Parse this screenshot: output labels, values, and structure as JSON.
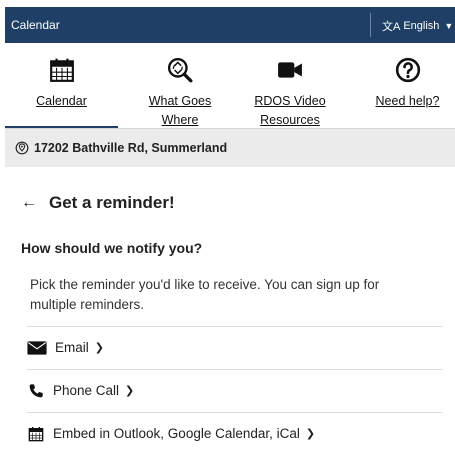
{
  "topbar": {
    "title": "Calendar",
    "language": "English",
    "language_icon": "translate-icon"
  },
  "nav": {
    "items": [
      {
        "label": "Calendar",
        "icon": "calendar-icon",
        "active": true
      },
      {
        "label": "What Goes Where",
        "icon": "recycle-search-icon",
        "active": false
      },
      {
        "label": "RDOS Video Resources",
        "icon": "video-camera-icon",
        "active": false
      },
      {
        "label": "Need help?",
        "icon": "question-circle-icon",
        "active": false
      }
    ]
  },
  "address": {
    "text": "17202 Bathville Rd, Summerland",
    "icon": "location-pin-icon"
  },
  "main": {
    "back_icon": "←",
    "heading": "Get a reminder!",
    "subheading": "How should we notify you?",
    "description": "Pick the reminder you'd like to receive. You can sign up for multiple reminders.",
    "options": [
      {
        "label": "Email",
        "icon": "envelope-icon"
      },
      {
        "label": "Phone Call",
        "icon": "phone-icon"
      },
      {
        "label": "Embed in Outlook, Google Calendar, iCal",
        "icon": "calendar-icon"
      }
    ]
  },
  "colors": {
    "brand_navy": "#1f3f66",
    "address_bg": "#ebebeb"
  }
}
